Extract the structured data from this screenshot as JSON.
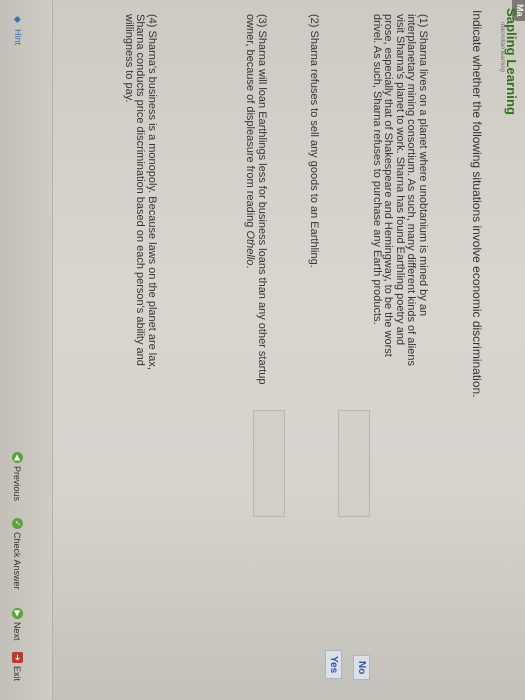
{
  "app": {
    "brand": "Sapling Learning",
    "tagline": "macmillan learning",
    "corner_tab": "Ma"
  },
  "question": {
    "instruction": "Indicate whether the following situations involve economic discrimination.",
    "items": [
      "(1) Sharna lives on a planet where unobtanium is mined by an interplanetary mining consortium. As such, many different kinds of aliens visit Sharna's planet to work. Sharna has found Earthling poetry and prose, especially that of Shakespeare and Hemingway, to be the worst drivel. As such, Sharna refuses to purchase any Earth products.",
      "(2) Sharna refuses to sell any goods to an Earthling.",
      "(3) Sharna will loan Earthlings less for business loans than any other startup owner, because of displeasure from reading ",
      "(4) Sharna's business is a monopoly. Because laws on the planet are lax, Sharna conducts price discrimination based on each person's ability and willingness to pay."
    ],
    "item3_italic": "Othello",
    "item3_end": ".",
    "choices": [
      "No",
      "Yes"
    ]
  },
  "footer": {
    "hint": "Hint",
    "previous": "Previous",
    "check_answer": "Check Answer",
    "next": "Next",
    "exit": "Exit"
  },
  "colors": {
    "brand_green": "#3a6b22",
    "link_blue": "#3b6fb4",
    "icon_green": "#5aa43a",
    "exit_red": "#c0392b"
  },
  "icons": {
    "hint": "lightbulb-icon",
    "previous": "arrow-left-icon",
    "check_answer": "check-icon",
    "next": "arrow-right-icon",
    "exit": "exit-icon"
  }
}
